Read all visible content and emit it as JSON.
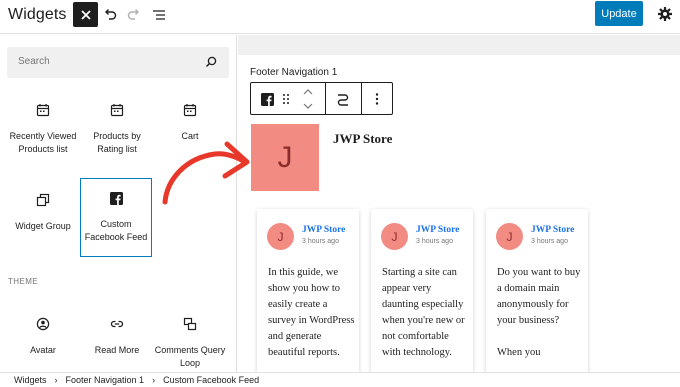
{
  "header": {
    "title": "Widgets",
    "update_label": "Update"
  },
  "sidebar": {
    "search_placeholder": "Search",
    "blocks": [
      {
        "label": "Recently Viewed Products list",
        "icon": "calendar-icon"
      },
      {
        "label": "Products by Rating list",
        "icon": "calendar-icon"
      },
      {
        "label": "Cart",
        "icon": "calendar-icon"
      },
      {
        "label": "Widget Group",
        "icon": "group-icon"
      },
      {
        "label": "Custom Facebook Feed",
        "icon": "facebook-icon"
      }
    ],
    "theme_section_label": "THEME",
    "theme_blocks": [
      {
        "label": "Avatar",
        "icon": "avatar-icon"
      },
      {
        "label": "Read More",
        "icon": "link-icon"
      },
      {
        "label": "Comments Query Loop",
        "icon": "comments-icon"
      }
    ]
  },
  "canvas": {
    "area_label": "Footer Navigation 1",
    "avatar_letter": "J",
    "store_name": "JWP Store",
    "posts": [
      {
        "author": "JWP Store",
        "time": "3 hours ago",
        "avatar": "J",
        "text": "In this guide, we show you how to easily create a survey in WordPress and generate beautiful reports."
      },
      {
        "author": "JWP Store",
        "time": "3 hours ago",
        "avatar": "J",
        "text": "Starting a site can appear very daunting especially when you're new or not comfortable with technology."
      },
      {
        "author": "JWP Store",
        "time": "3 hours ago",
        "avatar": "J",
        "text": "Do you want to buy a domain main anonymously for your business?\n\nWhen you"
      }
    ]
  },
  "breadcrumb": [
    "Widgets",
    "Footer Navigation 1",
    "Custom Facebook Feed"
  ],
  "colors": {
    "accent": "#007cba",
    "avatar_bg": "#f28b82",
    "arrow": "#e8382a",
    "link": "#1a73e8"
  }
}
